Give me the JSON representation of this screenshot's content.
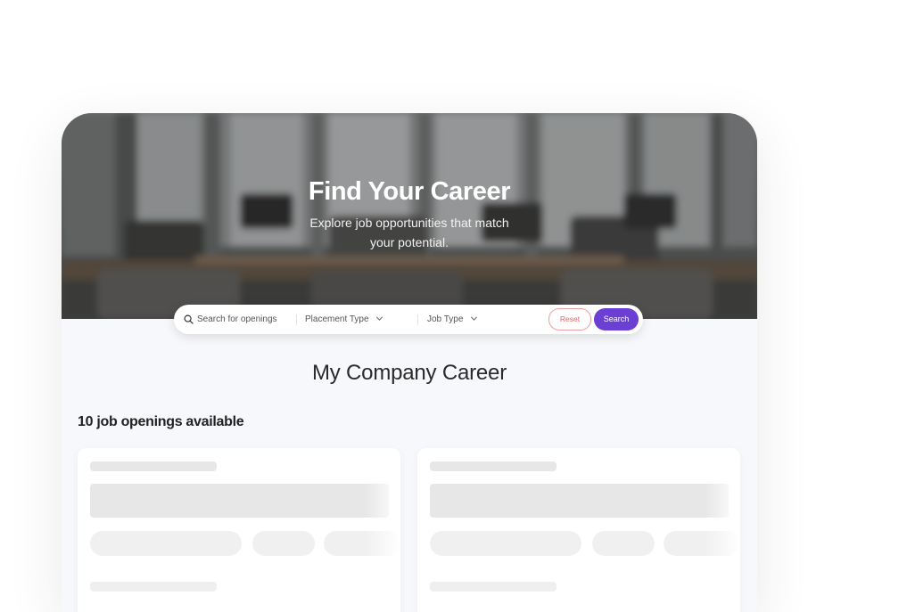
{
  "hero": {
    "title": "Find Your Career",
    "subtitle": "Explore job opportunities that match your potential."
  },
  "search": {
    "placeholder": "Search for openings",
    "placement_type_label": "Placement Type",
    "job_type_label": "Job Type",
    "reset_label": "Reset",
    "search_label": "Search"
  },
  "main": {
    "company_title": "My Company Career",
    "openings_text": "10 job openings available"
  },
  "colors": {
    "accent": "#6b3fd4",
    "reset_border": "#e8a0a0"
  }
}
